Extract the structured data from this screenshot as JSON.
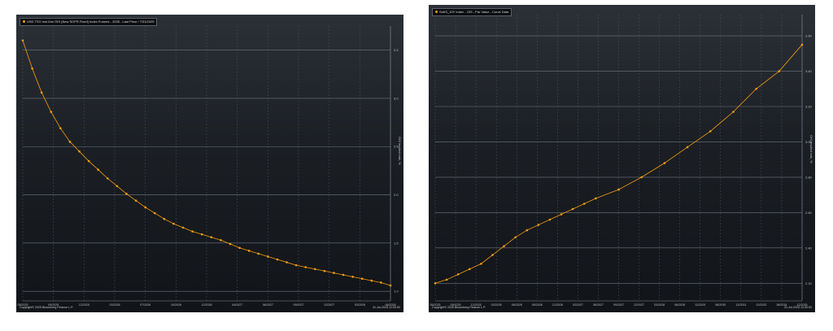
{
  "chart_data": [
    {
      "type": "line",
      "legend": "USD TSO Inst Aim OIS (New SOFR Fixed) Index Futures - 2035 - Last Price / 7/31/2025",
      "ylabel": "OIS Implied rate, %",
      "yticks": [
        "3.5",
        "3.0",
        "2.5",
        "2.0",
        "1.5",
        "1.0"
      ],
      "ylim": [
        0.9,
        3.75
      ],
      "xticks": [
        "05/2025",
        "09/2025",
        "12/2025",
        "03/2026",
        "07/2026",
        "10/2026",
        "12/2026",
        "04/2027",
        "06/2027",
        "09/2027",
        "12/2027",
        "03/2028",
        "06/2028"
      ],
      "x": [
        0,
        1,
        2,
        3,
        4,
        5,
        6,
        7,
        8,
        9,
        10,
        11,
        12,
        13,
        14,
        15,
        16,
        17,
        18,
        19,
        20,
        21,
        22,
        23,
        24,
        25,
        26,
        27,
        28,
        29,
        30,
        31,
        32,
        33,
        34,
        35,
        36,
        37,
        38,
        39
      ],
      "values": [
        3.6,
        3.31,
        3.06,
        2.86,
        2.69,
        2.55,
        2.45,
        2.35,
        2.26,
        2.17,
        2.09,
        2.01,
        1.94,
        1.87,
        1.81,
        1.75,
        1.7,
        1.66,
        1.62,
        1.59,
        1.56,
        1.53,
        1.49,
        1.45,
        1.42,
        1.39,
        1.36,
        1.33,
        1.3,
        1.27,
        1.25,
        1.23,
        1.21,
        1.19,
        1.17,
        1.15,
        1.13,
        1.11,
        1.09,
        1.06
      ],
      "color": "#f39c12",
      "footer_left": "Copyright© 2025 Bloomberg Finance L.P.",
      "footer_right": "31-Jul-2025 12:00:00"
    },
    {
      "type": "line",
      "legend": "SofrS_10Y Index - OIS - Par Value - Curve Data",
      "ylabel": "OIS Implied rate, %",
      "yticks": [
        "3.60",
        "3.40",
        "3.20",
        "3.00",
        "2.80",
        "2.60",
        "2.40",
        "2.20"
      ],
      "ylim": [
        2.1,
        3.72
      ],
      "xticks": [
        "06/2025",
        "09/2025",
        "12/2025",
        "03/2026",
        "06/2026",
        "09/2026",
        "12/2026",
        "03/2027",
        "06/2027",
        "09/2027",
        "12/2027",
        "03/2028",
        "06/2028",
        "12/2029",
        "06/2030",
        "12/2031",
        "12/2032",
        "06/2034",
        "12/2035"
      ],
      "x": [
        0,
        0.5,
        1,
        1.5,
        2,
        2.5,
        3,
        3.5,
        4,
        4.5,
        5,
        5.5,
        6,
        6.5,
        7,
        8,
        9,
        10,
        11,
        12,
        13,
        14,
        15,
        16
      ],
      "values": [
        2.2,
        2.22,
        2.25,
        2.28,
        2.31,
        2.36,
        2.41,
        2.46,
        2.5,
        2.53,
        2.56,
        2.59,
        2.62,
        2.65,
        2.68,
        2.73,
        2.8,
        2.88,
        2.97,
        3.06,
        3.17,
        3.3,
        3.4,
        3.55
      ],
      "color": "#f39c12",
      "footer_left": "Copyright© 2025 Bloomberg Finance L.P.",
      "footer_right": "31-Jul-2025 12:00:00"
    }
  ]
}
